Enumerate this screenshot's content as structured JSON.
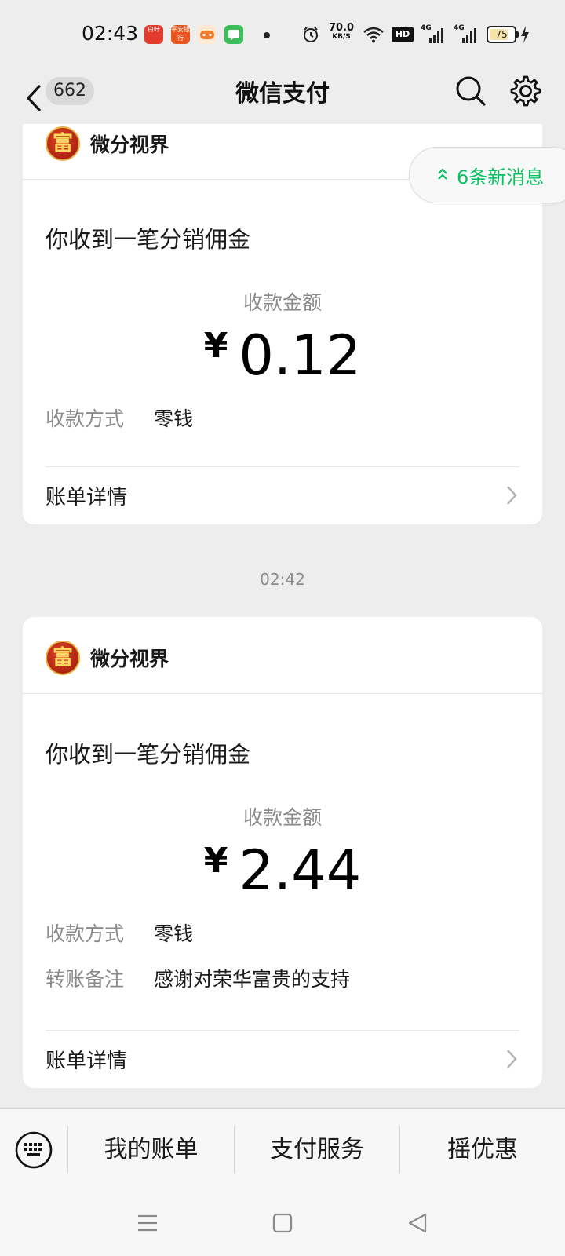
{
  "status_bar": {
    "time": "02:43",
    "app_icons": [
      {
        "name": "news-app-icon",
        "color": "#e23b2e",
        "text": "白叶"
      },
      {
        "name": "pingan-bank-icon",
        "color": "#e8561f",
        "text": "平安银行"
      },
      {
        "name": "game-app-icon",
        "color": "#f07c2c",
        "text": ""
      },
      {
        "name": "message-app-icon",
        "color": "#3cbf5a",
        "text": ""
      }
    ],
    "net_speed": "70.0",
    "net_speed_unit": "KB/S",
    "hd_label": "HD",
    "network_1": "4G",
    "network_2": "4G",
    "battery_level": "75",
    "battery_fraction": 0.75
  },
  "nav": {
    "unread_count": "662",
    "title": "微信支付"
  },
  "new_message_pill": "6条新消息",
  "cards": [
    {
      "merchant": "微分视界",
      "logo_char": "富",
      "title": "你收到一笔分销佣金",
      "amount_label": "收款金额",
      "currency": "¥",
      "amount": "0.12",
      "rows": [
        {
          "key": "收款方式",
          "value": "零钱"
        }
      ],
      "detail_label": "账单详情"
    },
    {
      "merchant": "微分视界",
      "logo_char": "富",
      "title": "你收到一笔分销佣金",
      "amount_label": "收款金额",
      "currency": "¥",
      "amount": "2.44",
      "rows": [
        {
          "key": "收款方式",
          "value": "零钱"
        },
        {
          "key": "转账备注",
          "value": "感谢对荣华富贵的支持"
        }
      ],
      "detail_label": "账单详情"
    }
  ],
  "time_divider": "02:42",
  "bottom_menu": [
    "我的账单",
    "支付服务",
    "摇优惠"
  ],
  "colors": {
    "accent_green": "#07c160",
    "background": "#ededed"
  }
}
